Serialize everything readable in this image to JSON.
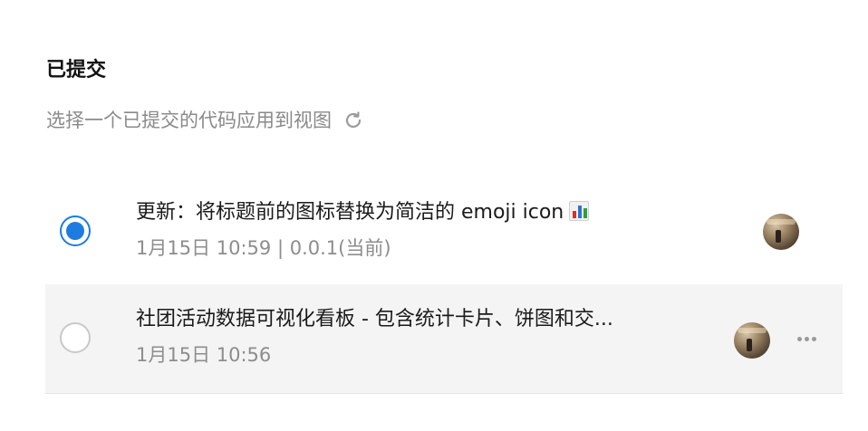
{
  "section": {
    "title": "已提交",
    "subtitle": "选择一个已提交的代码应用到视图",
    "refresh_icon": "refresh-icon"
  },
  "commits": [
    {
      "message": "更新：将标题前的图标替换为简洁的 emoji icon",
      "emoji_icon": "bar-chart-emoji-icon",
      "meta": "1月15日 10:59 | 0.0.1(当前)",
      "selected": true,
      "avatar_icon": "avatar"
    },
    {
      "message": "社团活动数据可视化看板 - 包含统计卡片、饼图和交...",
      "meta": "1月15日 10:56",
      "selected": false,
      "avatar_icon": "avatar",
      "more_icon": "more-icon"
    }
  ],
  "colors": {
    "accent": "#1e7be0",
    "selected_row_bg": "#ffffff",
    "hover_row_bg": "#f4f4f4",
    "muted_text": "#8a8a8a"
  }
}
